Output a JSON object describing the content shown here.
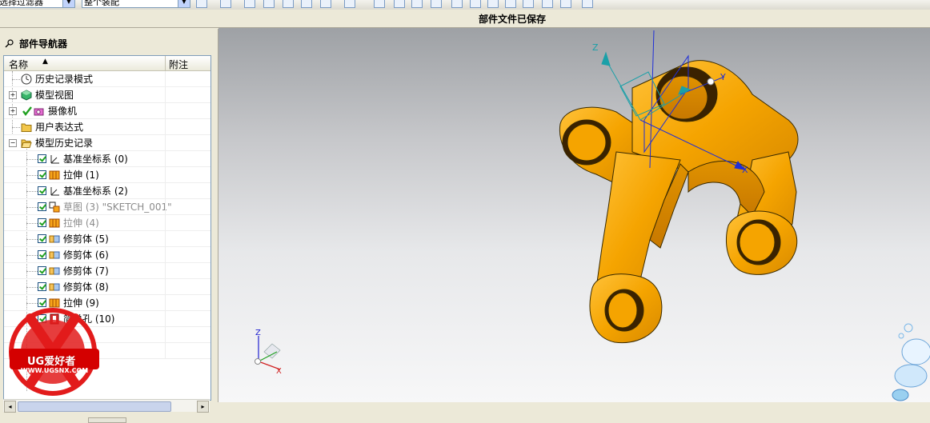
{
  "toolbar": {
    "filter_select": "选择过滤器",
    "scope_select": "整个装配"
  },
  "status": {
    "message": "部件文件已保存"
  },
  "navigator": {
    "title": "部件导航器",
    "columns": {
      "name": "名称",
      "note": "附注"
    },
    "rows": [
      {
        "label": "历史记录模式",
        "icon": "clock-icon"
      },
      {
        "label": "模型视图",
        "icon": "model-view-icon"
      },
      {
        "label": "摄像机",
        "icon": "camera-icon"
      },
      {
        "label": "用户表达式",
        "icon": "folder-icon"
      },
      {
        "label": "模型历史记录",
        "icon": "folder-open-icon"
      },
      {
        "label": "基准坐标系 (0)",
        "icon": "datum-csys-icon",
        "checked": true
      },
      {
        "label": "拉伸 (1)",
        "icon": "extrude-icon",
        "checked": true
      },
      {
        "label": "基准坐标系 (2)",
        "icon": "datum-csys-icon",
        "checked": true
      },
      {
        "label": "草图 (3) \"SKETCH_001\"",
        "icon": "sketch-icon",
        "checked": true,
        "muted": true
      },
      {
        "label": "拉伸 (4)",
        "icon": "extrude-icon",
        "checked": true,
        "muted": true
      },
      {
        "label": "修剪体 (5)",
        "icon": "trim-body-icon",
        "checked": true
      },
      {
        "label": "修剪体 (6)",
        "icon": "trim-body-icon",
        "checked": true
      },
      {
        "label": "修剪体 (7)",
        "icon": "trim-body-icon",
        "checked": true
      },
      {
        "label": "修剪体 (8)",
        "icon": "trim-body-icon",
        "checked": true
      },
      {
        "label": "拉伸 (9)",
        "icon": "extrude-icon",
        "checked": true
      },
      {
        "label": "简单孔 (10)",
        "icon": "hole-icon",
        "checked": true
      }
    ]
  },
  "viewport": {
    "axis_labels": {
      "x": "X",
      "y": "Y",
      "z": "Z"
    },
    "part_color": "#f5a400",
    "edge_color": "#3a2a00"
  },
  "watermark": {
    "brand": "UG爱好者",
    "url": "WWW.UGSNX.COM"
  },
  "colors": {
    "accent": "#f5a400",
    "check": "#21a121"
  }
}
